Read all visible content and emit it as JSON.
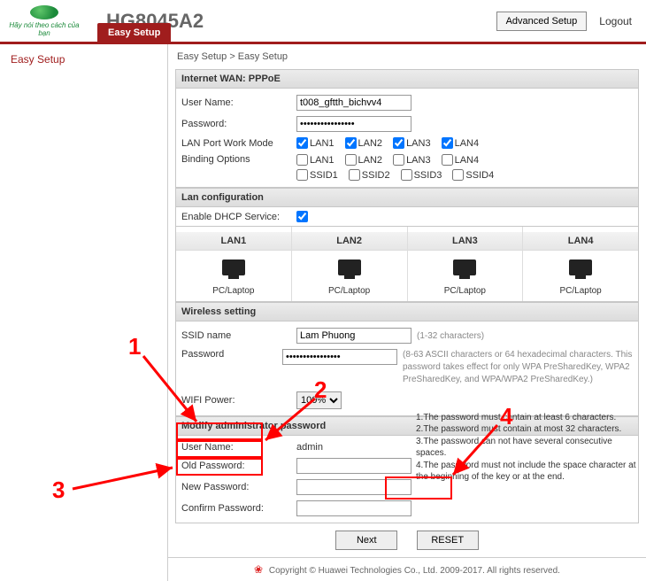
{
  "header": {
    "model": "HG8045A2",
    "advanced_button": "Advanced Setup",
    "logout": "Logout",
    "brand_tagline": "Hãy nói theo cách của bạn"
  },
  "tab": {
    "label": "Easy Setup"
  },
  "sidebar": {
    "items": [
      "Easy Setup"
    ]
  },
  "breadcrumb": "Easy Setup > Easy Setup",
  "wan": {
    "title": "Internet WAN: PPPoE",
    "labels": {
      "username": "User Name:",
      "password": "Password:",
      "lanport": "LAN Port Work Mode",
      "binding": "Binding Options"
    },
    "username": "t008_gftth_bichvv4",
    "password": "••••••••••••••••",
    "lanports": [
      "LAN1",
      "LAN2",
      "LAN3",
      "LAN4"
    ],
    "lanports_checked": [
      true,
      true,
      true,
      true
    ],
    "binding_lan": [
      "LAN1",
      "LAN2",
      "LAN3",
      "LAN4"
    ],
    "binding_lan_checked": [
      false,
      false,
      false,
      false
    ],
    "binding_ssid": [
      "SSID1",
      "SSID2",
      "SSID3",
      "SSID4"
    ],
    "binding_ssid_checked": [
      false,
      false,
      false,
      false
    ]
  },
  "lan": {
    "title": "Lan configuration",
    "dhcp_label": "Enable DHCP Service:",
    "dhcp_checked": true,
    "cols": [
      {
        "name": "LAN1",
        "desc": "PC/Laptop"
      },
      {
        "name": "LAN2",
        "desc": "PC/Laptop"
      },
      {
        "name": "LAN3",
        "desc": "PC/Laptop"
      },
      {
        "name": "LAN4",
        "desc": "PC/Laptop"
      }
    ]
  },
  "wireless": {
    "title": "Wireless setting",
    "ssid_label": "SSID name",
    "ssid_value": "Lam Phuong",
    "ssid_hint": "(1-32 characters)",
    "password_label": "Password",
    "password_value": "••••••••••••••••",
    "password_hint": "(8-63 ASCII characters or 64 hexadecimal characters. This password takes effect for only WPA PreSharedKey, WPA2 PreSharedKey, and WPA/WPA2 PreSharedKey.)",
    "wifi_power_label": "WIFI Power:",
    "wifi_power_value": "100%"
  },
  "admin": {
    "title": "Modify administrator password",
    "username_label": "User Name:",
    "username_value": "admin",
    "old_label": "Old Password:",
    "new_label": "New Password:",
    "confirm_label": "Confirm Password:",
    "rules": [
      "1.The password must contain at least 6 characters.",
      "2.The password must contain at most 32 characters.",
      "3.The password can not have several consecutive spaces.",
      "4.The password must not include the space character at the beginning of the key or at the end."
    ]
  },
  "buttons": {
    "next": "Next",
    "reset": "RESET"
  },
  "footer": "Copyright © Huawei Technologies Co., Ltd. 2009-2017. All rights reserved.",
  "annotations": {
    "n1": "1",
    "n2": "2",
    "n3": "3",
    "n4": "4"
  }
}
